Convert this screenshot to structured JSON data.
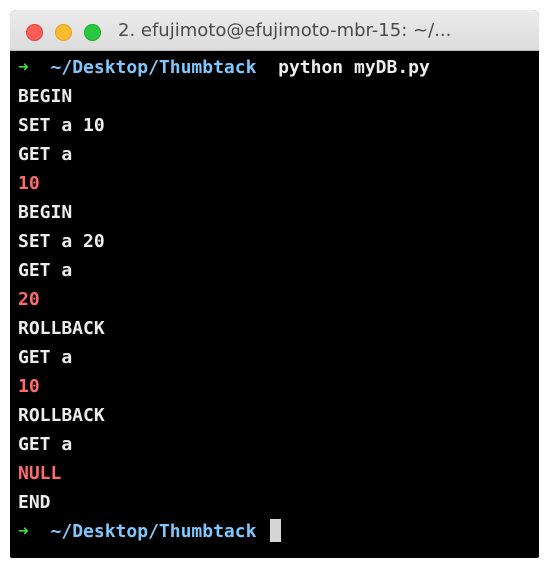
{
  "window": {
    "title": "2. efujimoto@efujimoto-mbr-15: ~/..."
  },
  "terminal": {
    "prompt_arrow": "➜",
    "prompt_path": "~/Desktop/Thumbtack",
    "command": "python myDB.py",
    "lines": [
      {
        "text": "BEGIN",
        "type": "input"
      },
      {
        "text": "SET a 10",
        "type": "input"
      },
      {
        "text": "GET a",
        "type": "input"
      },
      {
        "text": "10",
        "type": "output"
      },
      {
        "text": "BEGIN",
        "type": "input"
      },
      {
        "text": "SET a 20",
        "type": "input"
      },
      {
        "text": "GET a",
        "type": "input"
      },
      {
        "text": "20",
        "type": "output"
      },
      {
        "text": "ROLLBACK",
        "type": "input"
      },
      {
        "text": "GET a",
        "type": "input"
      },
      {
        "text": "10",
        "type": "output"
      },
      {
        "text": "ROLLBACK",
        "type": "input"
      },
      {
        "text": "GET a",
        "type": "input"
      },
      {
        "text": "NULL",
        "type": "output"
      },
      {
        "text": "END",
        "type": "input"
      }
    ]
  },
  "colors": {
    "prompt_arrow": "#3fd93f",
    "prompt_path": "#7ec8ff",
    "output": "#ff6b6b",
    "input": "#ececec"
  }
}
